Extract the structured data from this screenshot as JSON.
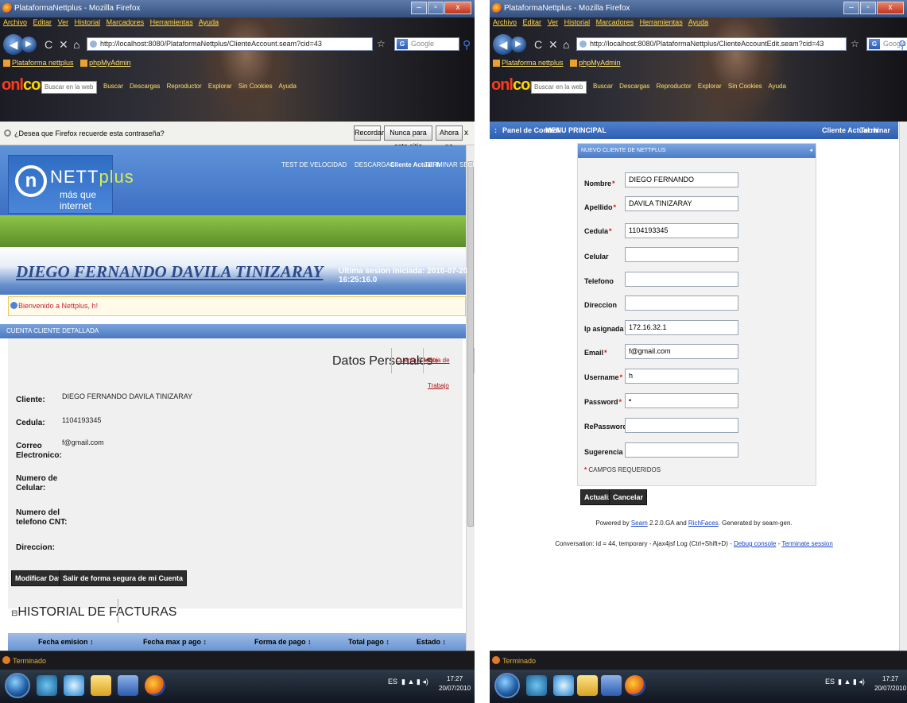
{
  "left": {
    "window_title": "PlataformaNettplus - Mozilla Firefox",
    "menu": [
      "Archivo",
      "Editar",
      "Ver",
      "Historial",
      "Marcadores",
      "Herramientas",
      "Ayuda"
    ],
    "url": "http://localhost:8080/PlataformaNettplus/ClienteAccount.seam?cid=43",
    "search_engine_placeholder": "Google",
    "bookmarks": [
      "Plataforma nettplus",
      "phpMyAdmin"
    ],
    "brand": {
      "a": "onl",
      "b": "com"
    },
    "buscar_placeholder": "Buscar en la web",
    "toolbar_items": [
      "Buscar",
      "Descargas",
      "Reproductor",
      "Explorar",
      "Sin Cookies",
      "Ayuda"
    ],
    "password_prompt": "¿Desea que Firefox recuerde esta contraseña?",
    "password_buttons": {
      "remember": "Recordar",
      "never": "Nunca para este sitio",
      "not_now": "Ahora no"
    },
    "password_close": "x",
    "logo": {
      "mark": "n",
      "word_a": "NETT",
      "word_b": "plus",
      "slogan": "más que internet"
    },
    "topnav": {
      "speed": "TEST DE VELOCIDAD",
      "downloads": "DESCARGAS",
      "current_client": "Cliente Actual: h",
      "logout": "TERMINAR SECION"
    },
    "client_name": "DIEGO FERNANDO DAVILA TINIZARAY",
    "last_session": "Ultima sesion iniciada: 2010-07-20 16:25:16.0",
    "welcome_message": "Bienvenido a Nettplus, h!",
    "section_title": "CUENTA CLIENTE DETALLADA",
    "personal_title": "Datos Personales",
    "tabs": [
      "Cuenta Cliente",
      "Hoja de Trabajo"
    ],
    "fields": {
      "cliente_label": "Cliente:",
      "cliente_value": "DIEGO FERNANDO DAVILA TINIZARAY",
      "cedula_label": "Cedula:",
      "cedula_value": "1104193345",
      "correo_label_1": "Correo",
      "correo_label_2": "Electronico:",
      "correo_value": "f@gmail.com",
      "celular_label_1": "Numero de",
      "celular_label_2": "Celular:",
      "telefono_label_1": "Numero del",
      "telefono_label_2": "telefono CNT:",
      "direccion_label": "Direccion:"
    },
    "buttons": {
      "modify": "Modificar Datos",
      "logout_secure": "Salir de forma segura de mi Cuenta"
    },
    "history_title": "HISTORIAL DE FACTURAS",
    "history_toggle": "⊟",
    "table_headers": [
      "Fecha emision ↕",
      "Fecha max p ago ↕",
      "Forma de pago ↕",
      "Total pago ↕",
      "Estado ↕"
    ],
    "status": "Terminado",
    "tray_lang": "ES",
    "clock_time": "17:27",
    "clock_date": "20/07/2010"
  },
  "right": {
    "window_title": "PlataformaNettplus - Mozilla Firefox",
    "menu": [
      "Archivo",
      "Editar",
      "Ver",
      "Historial",
      "Marcadores",
      "Herramientas",
      "Ayuda"
    ],
    "url": "http://localhost:8080/PlataformaNettplus/ClienteAccountEdit.seam?cid=43",
    "search_engine_placeholder": "Google",
    "bookmarks": [
      "Plataforma nettplus",
      "phpMyAdmin"
    ],
    "buscar_placeholder": "Buscar en la web",
    "toolbar_items": [
      "Buscar",
      "Descargas",
      "Reproductor",
      "Explorar",
      "Sin Cookies",
      "Ayuda"
    ],
    "nav": {
      "panel": "Panel de Control",
      "menu": "MENU PRINCIPAL",
      "current_client": "Cliente Actual: h",
      "logout": "Terminar Sesion",
      "leading": ":"
    },
    "panel_title": "NUEVO CLIENTE DE NETTPLUS",
    "form": [
      {
        "label": "Nombre",
        "required": true,
        "value": "DIEGO FERNANDO"
      },
      {
        "label": "Apellido",
        "required": true,
        "value": "DAVILA TINIZARAY"
      },
      {
        "label": "Cedula",
        "required": true,
        "value": "1104193345"
      },
      {
        "label": "Celular",
        "required": false,
        "value": ""
      },
      {
        "label": "Telefono",
        "required": false,
        "value": ""
      },
      {
        "label": "Direccion",
        "required": false,
        "value": ""
      },
      {
        "label": "Ip asignada",
        "required": true,
        "value": "172.16.32.1"
      },
      {
        "label": "Email",
        "required": true,
        "value": "f@gmail.com"
      },
      {
        "label": "Username",
        "required": true,
        "value": "h"
      },
      {
        "label": "Password",
        "required": true,
        "value": "•"
      },
      {
        "label": "RePassword",
        "required": true,
        "value": ""
      },
      {
        "label": "Sugerencia clave",
        "required": false,
        "value": ""
      }
    ],
    "required_mark": "*",
    "required_note": "CAMPOS REQUERIDOS",
    "buttons": {
      "update": "Actualizar",
      "cancel": "Cancelar"
    },
    "footer1": {
      "a": "Powered by ",
      "seam": "Seam",
      "b": " 2.2.0.GA and ",
      "rich": "RichFaces",
      "c": ". Generated by seam-gen."
    },
    "footer2": {
      "a": "Conversation: id = 44, temporary - Ajax4jsf Log (Ctrl+Shift+D) - ",
      "debug": "Debug console",
      "b": " - ",
      "term": "Terminate session"
    },
    "status": "Terminado",
    "tray_lang": "ES",
    "clock_time": "17:27",
    "clock_date": "20/07/2010"
  }
}
